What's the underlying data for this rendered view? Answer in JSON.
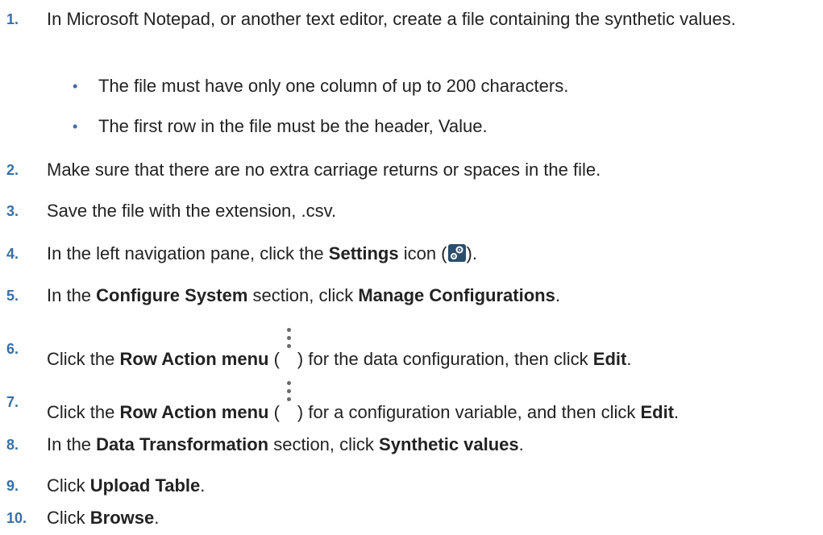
{
  "steps": [
    {
      "number": "1.",
      "text": "In Microsoft Notepad, or another text editor, create a file containing the synthetic values."
    },
    {
      "number": "2.",
      "text": "Make sure that there are no extra carriage returns or spaces in the file."
    },
    {
      "number": "3.",
      "text": "Save the file with the extension, .csv."
    },
    {
      "number": "4.",
      "pre": "In the left navigation pane, click the ",
      "bold1": "Settings",
      "mid": " icon (",
      "post": ")."
    },
    {
      "number": "5.",
      "pre": "In the ",
      "bold1": "Configure System",
      "mid": " section, click ",
      "bold2": "Manage Configurations",
      "post": "."
    },
    {
      "number": "6.",
      "pre": "Click the ",
      "bold1": "Row Action menu",
      "mid": " (",
      "post": ") for the data configuration, then click ",
      "bold2": "Edit",
      "end": "."
    },
    {
      "number": "7.",
      "pre": "Click the ",
      "bold1": "Row Action menu",
      "mid": " (",
      "post": ") for a configuration variable, and then click ",
      "bold2": "Edit",
      "end": "."
    },
    {
      "number": "8.",
      "pre": "In the ",
      "bold1": "Data Transformation",
      "mid": " section, click ",
      "bold2": "Synthetic values",
      "post": "."
    },
    {
      "number": "9.",
      "pre": "Click ",
      "bold1": "Upload Table",
      "post": "."
    },
    {
      "number": "10.",
      "pre": "Click ",
      "bold1": "Browse",
      "post": "."
    }
  ],
  "bullets": [
    "The file must have only one column of up to 200 characters.",
    "The first row in the file must be the header, Value."
  ],
  "colors": {
    "step_number": "#3a6ea5",
    "bullet": "#3a6ea5",
    "text": "#222222"
  }
}
